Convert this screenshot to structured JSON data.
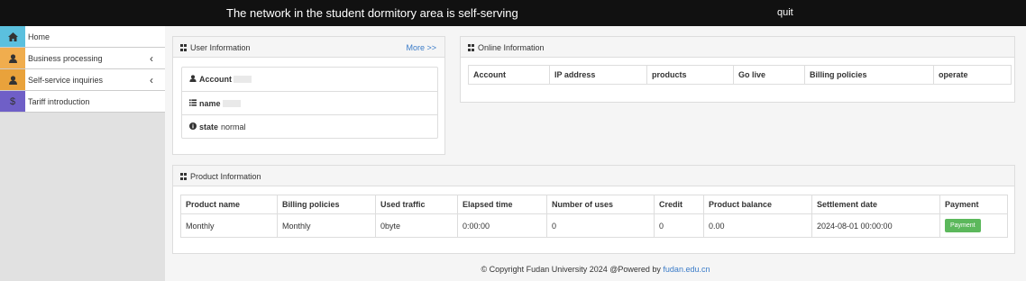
{
  "header": {
    "title": "The network in the student dormitory area is self-serving",
    "quit_label": "quit"
  },
  "sidebar": {
    "items": [
      {
        "label": "Home",
        "icon": "home-icon",
        "color": "#5bc0de"
      },
      {
        "label": "Business processing",
        "icon": "user-icon",
        "color": "#f0ad4e"
      },
      {
        "label": "Self-service inquiries",
        "icon": "user-icon",
        "color": "#e9a23b"
      },
      {
        "label": "Tariff introduction",
        "icon": "dollar-icon",
        "color": "#6f5fc7"
      }
    ]
  },
  "user_info": {
    "title": "User Information",
    "more_label": "More >>",
    "rows": [
      {
        "label": "Account",
        "value": ""
      },
      {
        "label": "name",
        "value": ""
      },
      {
        "label": "state",
        "value": "normal"
      }
    ]
  },
  "online_info": {
    "title": "Online Information",
    "columns": [
      "Account",
      "IP address",
      "products",
      "Go live",
      "Billing policies",
      "operate"
    ]
  },
  "product_info": {
    "title": "Product Information",
    "columns": [
      "Product name",
      "Billing policies",
      "Used traffic",
      "Elapsed time",
      "Number of uses",
      "Credit",
      "Product balance",
      "Settlement date",
      "Payment"
    ],
    "rows": [
      [
        "Monthly",
        "Monthly",
        "0byte",
        "0:00:00",
        "0",
        "0",
        "0.00",
        "2024-08-01 00:00:00"
      ]
    ],
    "payment_button_label": "Payment"
  },
  "footer": {
    "text": "© Copyright Fudan University 2024 @Powered by",
    "link": "fudan.edu.cn"
  }
}
